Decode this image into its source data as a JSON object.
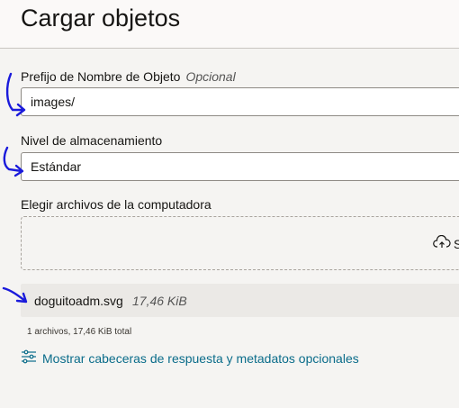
{
  "page": {
    "title": "Cargar objetos"
  },
  "prefix": {
    "label": "Prefijo de Nombre de Objeto",
    "optional": "Opcional",
    "value": "images/"
  },
  "storage": {
    "label": "Nivel de almacenamiento",
    "value": "Estándar"
  },
  "files": {
    "label": "Elegir archivos de la computadora",
    "upload_partial": "S",
    "items": [
      {
        "name": "doguitoadm.svg",
        "size": "17,46 KiB"
      }
    ],
    "summary": "1 archivos, 17,46 KiB total"
  },
  "advanced": {
    "link_text": "Mostrar cabeceras de respuesta y metadatos opcionales"
  },
  "colors": {
    "link": "#0a6c8a",
    "annotation": "#1a1adb"
  },
  "icons": [
    "upload-cloud-icon",
    "sliders-icon"
  ]
}
